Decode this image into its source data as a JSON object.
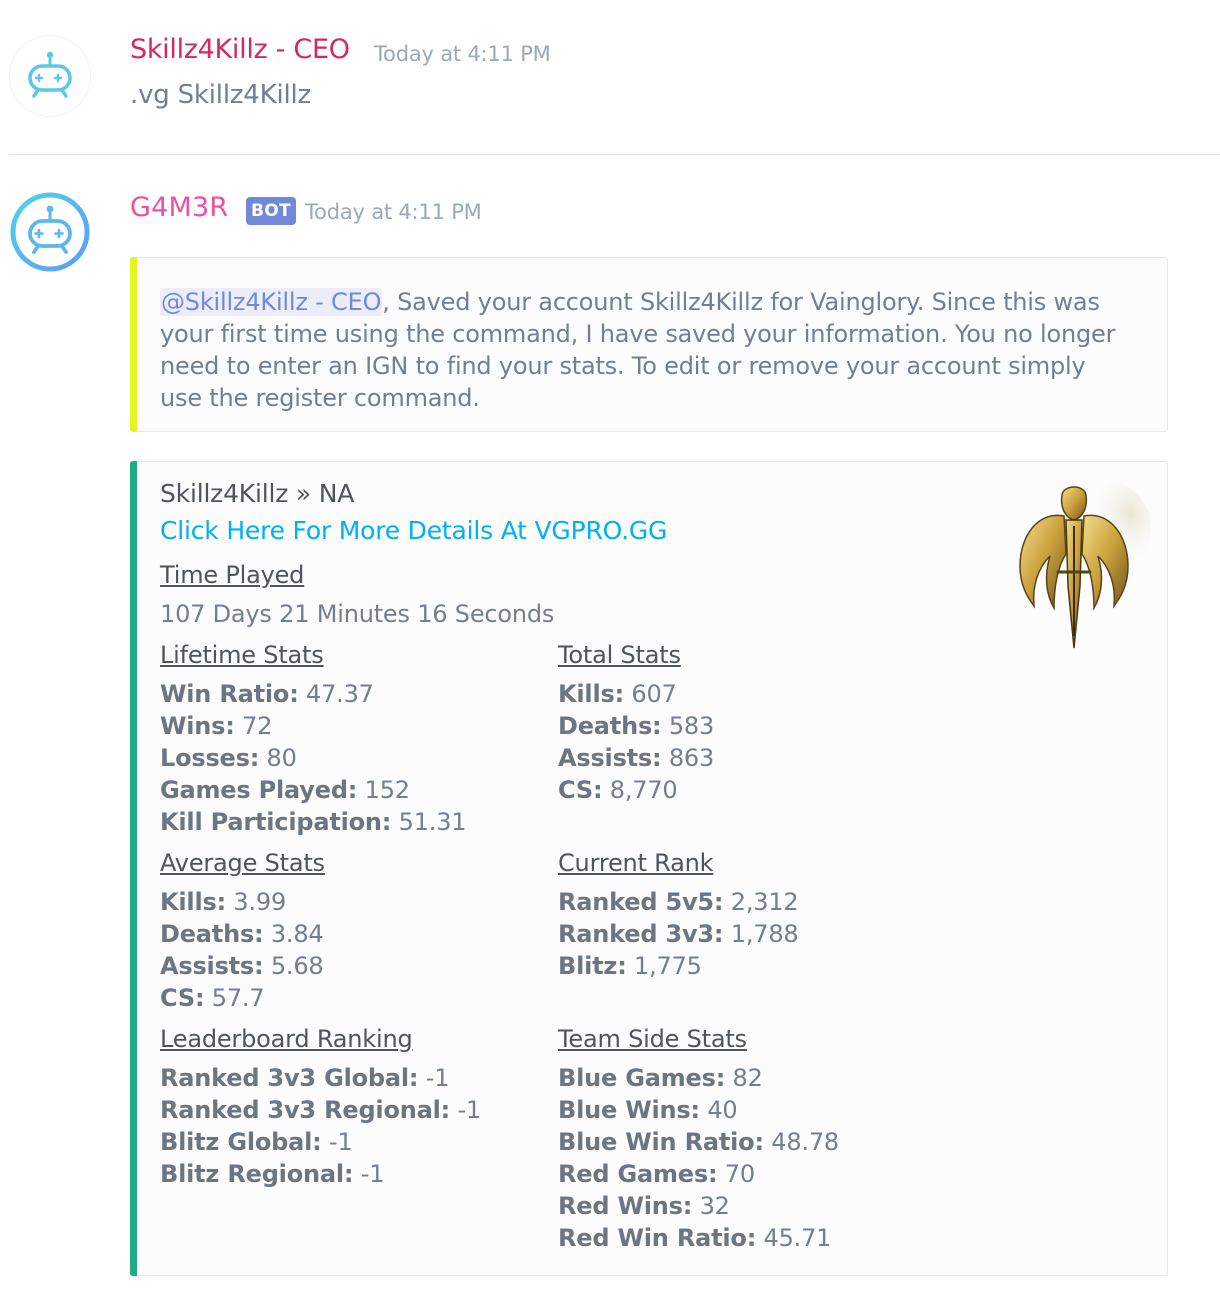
{
  "message1": {
    "username": "Skillz4Killz - CEO",
    "timestamp": "Today at 4:11 PM",
    "content": ".vg Skillz4Killz"
  },
  "message2": {
    "username": "G4M3R",
    "badge": "BOT",
    "timestamp": "Today at 4:11 PM",
    "embed1": {
      "mention": "@Skillz4Killz - CEO",
      "text": ", Saved your account Skillz4Killz for Vainglory. Since this was your first time using the command, I have saved your information. You no longer need to enter an IGN to find your stats. To edit or remove your account simply use the register command."
    },
    "embed2": {
      "author": "Skillz4Killz » NA",
      "link": "Click Here For More Details At VGPRO.GG",
      "fields": {
        "time_played": {
          "name": "Time Played",
          "value": "107 Days 21 Minutes 16 Seconds"
        },
        "lifetime": {
          "name": "Lifetime Stats",
          "items": [
            {
              "label": "Win Ratio:",
              "value": " 47.37"
            },
            {
              "label": "Wins:",
              "value": " 72"
            },
            {
              "label": "Losses:",
              "value": " 80"
            },
            {
              "label": "Games Played:",
              "value": " 152"
            },
            {
              "label": "Kill Participation:",
              "value": " 51.31"
            }
          ]
        },
        "total": {
          "name": "Total Stats",
          "items": [
            {
              "label": "Kills:",
              "value": " 607"
            },
            {
              "label": "Deaths:",
              "value": " 583"
            },
            {
              "label": "Assists:",
              "value": " 863"
            },
            {
              "label": "CS:",
              "value": " 8,770"
            }
          ]
        },
        "average": {
          "name": "Average Stats",
          "items": [
            {
              "label": "Kills:",
              "value": " 3.99"
            },
            {
              "label": "Deaths:",
              "value": " 3.84"
            },
            {
              "label": "Assists:",
              "value": " 5.68"
            },
            {
              "label": "CS:",
              "value": " 57.7"
            }
          ]
        },
        "rank": {
          "name": "Current Rank",
          "items": [
            {
              "label": "Ranked 5v5:",
              "value": " 2,312"
            },
            {
              "label": "Ranked 3v3:",
              "value": " 1,788"
            },
            {
              "label": "Blitz:",
              "value": " 1,775"
            }
          ]
        },
        "leaderboard": {
          "name": "Leaderboard Ranking",
          "items": [
            {
              "label": "Ranked 3v3 Global:",
              "value": " -1"
            },
            {
              "label": "Ranked 3v3 Regional:",
              "value": " -1"
            },
            {
              "label": "Blitz Global:",
              "value": " -1"
            },
            {
              "label": "Blitz Regional:",
              "value": " -1"
            }
          ]
        },
        "team_side": {
          "name": "Team Side Stats",
          "items": [
            {
              "label": "Blue Games:",
              "value": " 82"
            },
            {
              "label": "Blue Wins:",
              "value": " 40"
            },
            {
              "label": "Blue Win Ratio:",
              "value": " 48.78"
            },
            {
              "label": "Red Games:",
              "value": " 70"
            },
            {
              "label": "Red Wins:",
              "value": " 32"
            },
            {
              "label": "Red Win Ratio:",
              "value": " 45.71"
            }
          ]
        }
      }
    }
  },
  "icons": {
    "avatar": "robot-gamepad-icon",
    "thumbnail": "golden-winged-emblem-icon"
  },
  "colors": {
    "ceo_name": "#d6275e",
    "bot_name": "#ee4fa3",
    "bot_badge": "#7289da",
    "embed1_bar": "#e6f422",
    "embed2_bar": "#1dac85",
    "link": "#00b0f4"
  }
}
